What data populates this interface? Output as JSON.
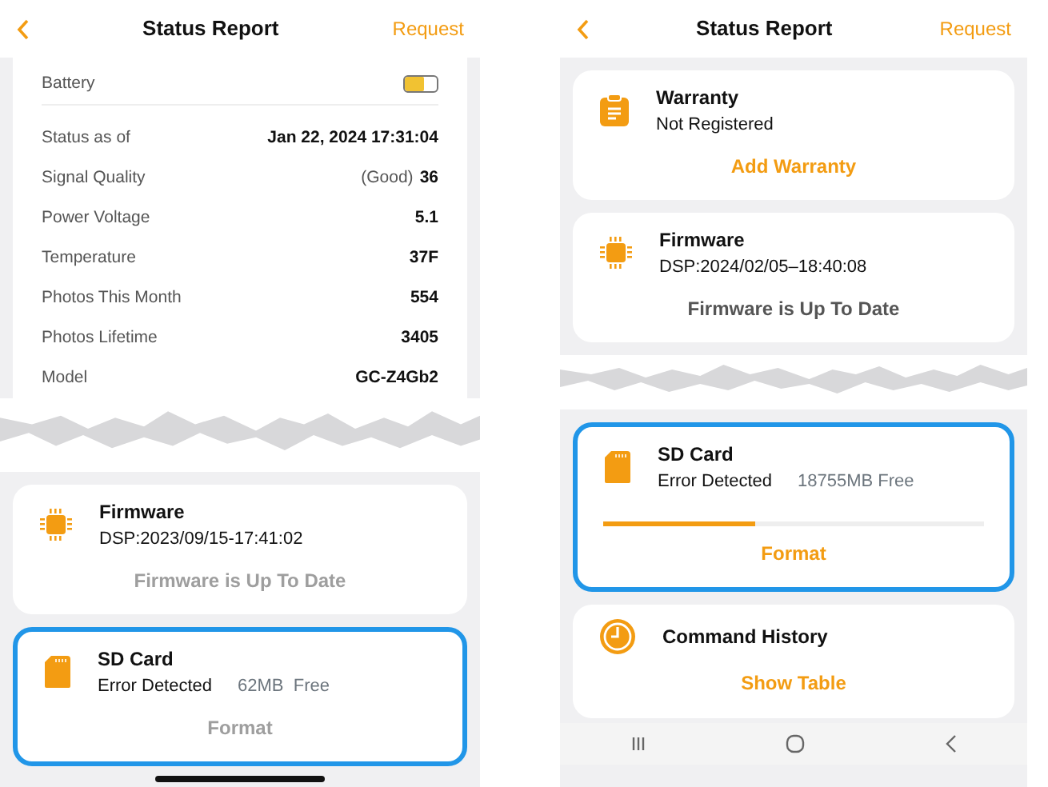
{
  "panels": [
    {
      "header": {
        "title": "Status Report",
        "action": "Request"
      },
      "stats": {
        "battery": {
          "label": "Battery",
          "level": 0.6
        },
        "rows": [
          {
            "label": "Status as of",
            "value": "Jan 22, 2024 17:31:04"
          },
          {
            "label": "Signal Quality",
            "note": "(Good)",
            "value": "36"
          },
          {
            "label": "Power Voltage",
            "value": "5.1"
          },
          {
            "label": "Temperature",
            "value": "37F"
          },
          {
            "label": "Photos This Month",
            "value": "554"
          },
          {
            "label": "Photos Lifetime",
            "value": "3405"
          },
          {
            "label": "Model",
            "value": "GC-Z4Gb2"
          }
        ]
      },
      "after_tear": [
        {
          "kind": "chip",
          "title": "Firmware",
          "lines": [
            "DSP:2023/09/15-17:41:02"
          ],
          "action": {
            "label": "Firmware is Up To Date",
            "disabled": true
          },
          "highlighted": false
        },
        {
          "kind": "sdcard",
          "title": "SD Card",
          "lines": [
            "Error Detected"
          ],
          "free": "62MB  Free",
          "action": {
            "label": "Format",
            "disabled": true
          },
          "highlighted": true
        }
      ]
    },
    {
      "header": {
        "title": "Status Report",
        "action": "Request"
      },
      "before_tear": [
        {
          "kind": "clipboard",
          "title": "Warranty",
          "lines": [
            "Not Registered"
          ],
          "action": {
            "label": "Add Warranty",
            "disabled": false
          },
          "highlighted": false
        },
        {
          "kind": "chip",
          "title": "Firmware",
          "lines": [
            "DSP:2024/02/05–18:40:08"
          ],
          "action": {
            "label": "Firmware is Up To Date",
            "disabled": false
          },
          "highlighted": false
        }
      ],
      "after_tear": [
        {
          "kind": "sdcard",
          "title": "SD Card",
          "lines": [
            "Error Detected"
          ],
          "free": "18755MB Free",
          "level": 0.4,
          "action": {
            "label": "Format",
            "disabled": false
          },
          "highlighted": true
        },
        {
          "kind": "clock",
          "title": "Command History",
          "action": {
            "label": "Show Table",
            "disabled": false
          },
          "highlighted": false
        }
      ]
    }
  ]
}
